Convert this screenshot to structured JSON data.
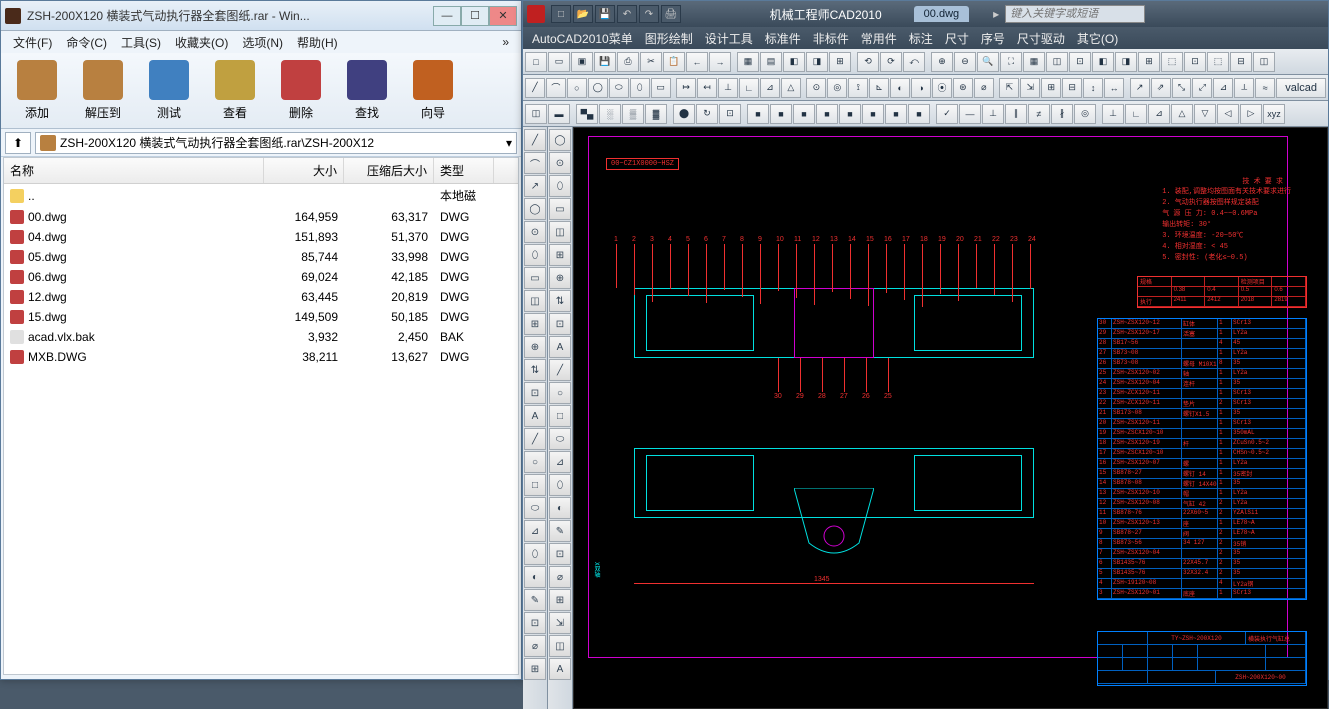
{
  "rar": {
    "title": "ZSH-200X120 横装式气动执行器全套图纸.rar - Win...",
    "menu": [
      "文件(F)",
      "命令(C)",
      "工具(S)",
      "收藏夹(O)",
      "选项(N)",
      "帮助(H)"
    ],
    "toolbar": [
      {
        "label": "添加",
        "color": "#b88040"
      },
      {
        "label": "解压到",
        "color": "#b88040"
      },
      {
        "label": "测试",
        "color": "#4080c0"
      },
      {
        "label": "查看",
        "color": "#c0a040"
      },
      {
        "label": "删除",
        "color": "#c04040"
      },
      {
        "label": "查找",
        "color": "#404080"
      },
      {
        "label": "向导",
        "color": "#c06020"
      }
    ],
    "path": "ZSH-200X120 横装式气动执行器全套图纸.rar\\ZSH-200X12",
    "columns": {
      "name": "名称",
      "size": "大小",
      "packed": "压缩后大小",
      "type": "类型"
    },
    "rows": [
      {
        "name": "..",
        "size": "",
        "packed": "",
        "type": "本地磁",
        "kind": "folder"
      },
      {
        "name": "00.dwg",
        "size": "164,959",
        "packed": "63,317",
        "type": "DWG",
        "kind": "dwg"
      },
      {
        "name": "04.dwg",
        "size": "151,893",
        "packed": "51,370",
        "type": "DWG",
        "kind": "dwg"
      },
      {
        "name": "05.dwg",
        "size": "85,744",
        "packed": "33,998",
        "type": "DWG",
        "kind": "dwg"
      },
      {
        "name": "06.dwg",
        "size": "69,024",
        "packed": "42,185",
        "type": "DWG",
        "kind": "dwg"
      },
      {
        "name": "12.dwg",
        "size": "63,445",
        "packed": "20,819",
        "type": "DWG",
        "kind": "dwg"
      },
      {
        "name": "15.dwg",
        "size": "149,509",
        "packed": "50,185",
        "type": "DWG",
        "kind": "dwg"
      },
      {
        "name": "acad.vlx.bak",
        "size": "3,932",
        "packed": "2,450",
        "type": "BAK",
        "kind": "file"
      },
      {
        "name": "MXB.DWG",
        "size": "38,211",
        "packed": "13,627",
        "type": "DWG",
        "kind": "dwg"
      }
    ]
  },
  "cad": {
    "apptitle": "机械工程师CAD2010",
    "tab": "00.dwg",
    "searchPlaceholder": "键入关键字或短语",
    "menu": [
      "AutoCAD2010菜单",
      "图形绘制",
      "设计工具",
      "标准件",
      "非标件",
      "常用件",
      "标注",
      "尺寸",
      "序号",
      "尺寸驱动",
      "其它(O)"
    ],
    "valcad": "valcad",
    "drawing": {
      "code": "00~CZ1X0000~HSZ",
      "notesTitle": "技  术  要  求",
      "notes": [
        "1. 装配,调整均按图面有关技术要求进行",
        "2. 气动执行器按图样规定装配",
        "    气 源 压 力: 0.4~~0.6MPa",
        "    输出转矩: 30°",
        "3. 环境温度: -20~50℃",
        "4. 相对湿度: < 45",
        "5. 密封性: (老化≤~0.5)"
      ],
      "props": [
        [
          "规格",
          "",
          "",
          "检测项目",
          ""
        ],
        [
          "",
          "0.38",
          "0.4",
          "0.5",
          "0.6"
        ],
        [
          "执行",
          "2411",
          "2412",
          "2018",
          "2819"
        ]
      ],
      "topnums": [
        "1",
        "2",
        "3",
        "4",
        "5",
        "6",
        "7",
        "8",
        "9",
        "10",
        "11",
        "12",
        "13",
        "14",
        "15",
        "16",
        "17",
        "18",
        "19",
        "20",
        "21",
        "22",
        "23",
        "24"
      ],
      "botnums": [
        "30",
        "29",
        "28",
        "27",
        "26",
        "25"
      ],
      "dim": "1345",
      "bom": [
        [
          "30",
          "ZSH~ZSX120~12",
          "缸体",
          "1",
          "SCr13"
        ],
        [
          "29",
          "ZSH~ZSX120~17",
          "活塞",
          "1",
          "LY2a"
        ],
        [
          "28",
          "SB17~56",
          "",
          "4",
          "45"
        ],
        [
          "27",
          "SB73~08",
          "",
          "1",
          "LY2a"
        ],
        [
          "26",
          "SB73~08",
          "螺母 M10X18",
          "8",
          "35"
        ],
        [
          "25",
          "ZSH~ZSX120~02",
          "轴",
          "1",
          "LY2a"
        ],
        [
          "24",
          "ZSH~ZSX120~04",
          "连杆",
          "1",
          "35"
        ],
        [
          "23",
          "ZSH~ZCX120~11",
          "",
          "1",
          "SCr13"
        ],
        [
          "22",
          "ZSH~ZCX120~11",
          "垫片",
          "2",
          "SCr13"
        ],
        [
          "21",
          "SB173~08",
          "螺钉X1.5",
          "1",
          "35"
        ],
        [
          "20",
          "ZSH~ZSX120~11",
          "",
          "1",
          "SCr13"
        ],
        [
          "19",
          "ZSH~ZSCX120~10",
          "",
          "1",
          "350mAL"
        ],
        [
          "18",
          "ZSH~ZSX120~19",
          "杆",
          "1",
          "ZCuSn0.5~2"
        ],
        [
          "17",
          "ZSH~ZSCX120~10",
          "",
          "1",
          "CHSn~0.5~2"
        ],
        [
          "16",
          "ZSH~ZSX120~07",
          "螺",
          "1",
          "LY2a"
        ],
        [
          "15",
          "SB878~27",
          "螺钉 14",
          "1",
          "35密封"
        ],
        [
          "14",
          "SB878~08",
          "螺钉 14X40",
          "1",
          "35"
        ],
        [
          "13",
          "ZSH~ZSX120~10",
          "帽",
          "1",
          "LY2a"
        ],
        [
          "12",
          "ZSH~ZSX120~08",
          "气缸 42",
          "2",
          "LY2a"
        ],
        [
          "11",
          "SB878~76",
          "22X60~5",
          "2",
          "YZAlSi1"
        ],
        [
          "10",
          "ZSH~ZSX120~13",
          "座",
          "1",
          "LE78~A"
        ],
        [
          "9",
          "SB878~27",
          "阀",
          "2",
          "LE78~A"
        ],
        [
          "8",
          "SB873~56",
          "34 127",
          "2",
          "35销"
        ],
        [
          "7",
          "ZSH~ZSX120~04",
          "",
          "2",
          "35"
        ],
        [
          "6",
          "SB1435~76",
          "22X45.7",
          "2",
          "35"
        ],
        [
          "5",
          "SB1435~76",
          "32X32.4",
          "2",
          "35"
        ],
        [
          "4",
          "ZSH~19120~08",
          "",
          "4",
          "LY2a钢"
        ],
        [
          "3",
          "ZSH~ZSX120~01",
          "底座",
          "1",
          "SCr13"
        ]
      ],
      "tb": {
        "product": "TY~ZSH~200X120",
        "name": "横装执行气缸总",
        "material": "",
        "dwgno": "ZSH~200X120~00"
      }
    }
  }
}
